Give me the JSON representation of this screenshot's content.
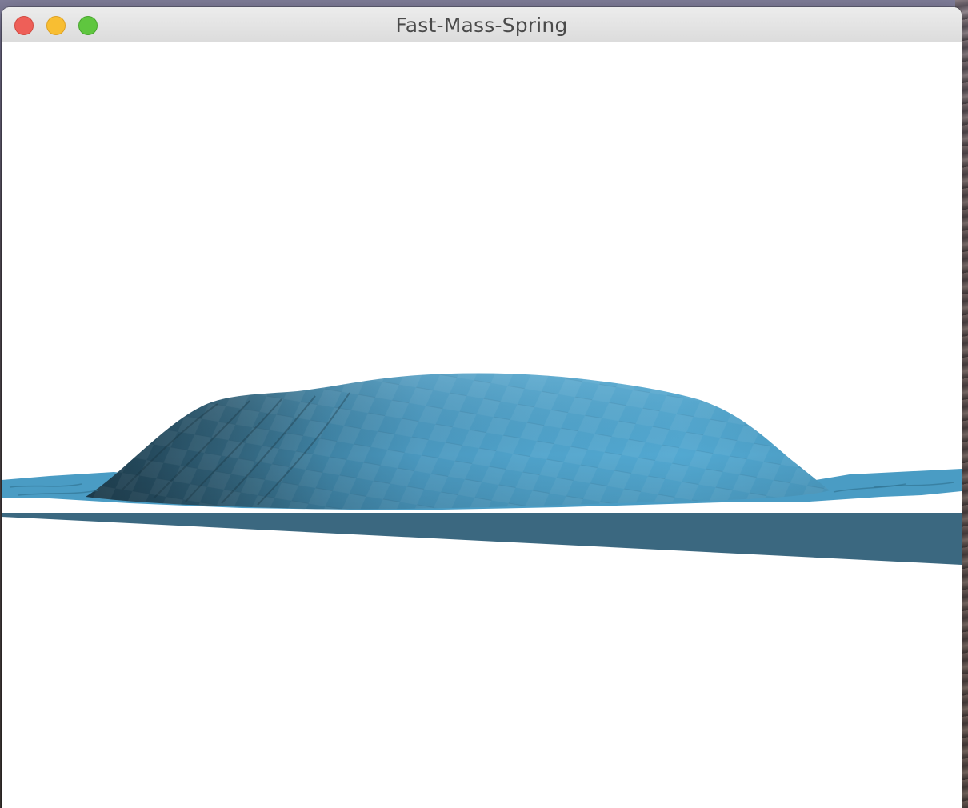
{
  "window": {
    "title": "Fast-Mass-Spring",
    "controls": {
      "close_icon": "close-icon",
      "minimize_icon": "minimize-icon",
      "zoom_icon": "zoom-icon"
    }
  },
  "scene": {
    "background_color": "#ffffff",
    "mesh_color": "#4fa3cc",
    "mesh_shadow_color": "#1e3d4d",
    "plane_color": "#3b6880"
  }
}
